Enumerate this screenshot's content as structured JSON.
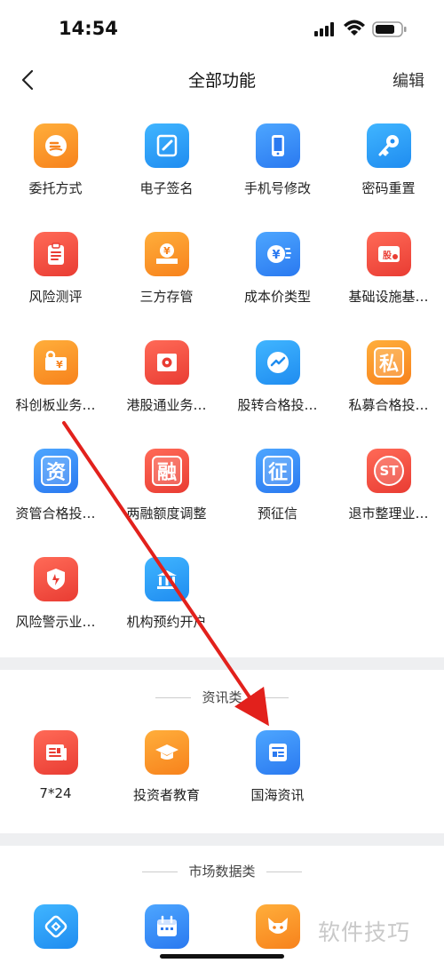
{
  "status_bar": {
    "time": "14:54"
  },
  "nav": {
    "title": "全部功能",
    "edit_label": "编辑"
  },
  "tools": [
    {
      "label": "委托方式",
      "icon": "hand-coin-icon",
      "color": "orange"
    },
    {
      "label": "电子签名",
      "icon": "pen-note-icon",
      "color": "cyan"
    },
    {
      "label": "手机号修改",
      "icon": "phone-icon",
      "color": "blue"
    },
    {
      "label": "密码重置",
      "icon": "key-icon",
      "color": "cyan"
    },
    {
      "label": "风险测评",
      "icon": "clipboard-icon",
      "color": "red"
    },
    {
      "label": "三方存管",
      "icon": "money-tray-icon",
      "color": "orange"
    },
    {
      "label": "成本价类型",
      "icon": "yen-coin-icon",
      "color": "blue"
    },
    {
      "label": "基础设施基…",
      "icon": "fund-card-icon",
      "color": "red"
    },
    {
      "label": "科创板业务…",
      "icon": "yen-key-icon",
      "color": "orange"
    },
    {
      "label": "港股通业务…",
      "icon": "hk-flag-icon",
      "color": "red"
    },
    {
      "label": "股转合格投…",
      "icon": "trend-chat-icon",
      "color": "cyan"
    },
    {
      "label": "私募合格投…",
      "icon": "private-icon",
      "color": "orange",
      "glyph": "私"
    },
    {
      "label": "资管合格投…",
      "icon": "asset-icon",
      "color": "blue",
      "glyph": "资"
    },
    {
      "label": "两融额度调整",
      "icon": "margin-icon",
      "color": "red",
      "glyph": "融"
    },
    {
      "label": "预征信",
      "icon": "credit-shield-icon",
      "color": "blue",
      "glyph": "征"
    },
    {
      "label": "退市整理业…",
      "icon": "st-badge-icon",
      "color": "red",
      "glyph": "ST"
    },
    {
      "label": "风险警示业…",
      "icon": "warning-shield-icon",
      "color": "red"
    },
    {
      "label": "机构预约开户",
      "icon": "institution-icon",
      "color": "cyan"
    }
  ],
  "news_section": {
    "title": "资讯类",
    "items": [
      {
        "label": "7*24",
        "icon": "newspaper-icon",
        "color": "red"
      },
      {
        "label": "投资者教育",
        "icon": "graduation-cap-icon",
        "color": "orange"
      },
      {
        "label": "国海资讯",
        "icon": "news-card-icon",
        "color": "blue"
      }
    ]
  },
  "market_section": {
    "title": "市场数据类",
    "items": [
      {
        "icon": "link-chain-icon",
        "color": "cyan"
      },
      {
        "icon": "calendar-icon",
        "color": "blue"
      },
      {
        "icon": "fox-icon",
        "color": "orange"
      }
    ]
  },
  "watermark": "软件技巧"
}
